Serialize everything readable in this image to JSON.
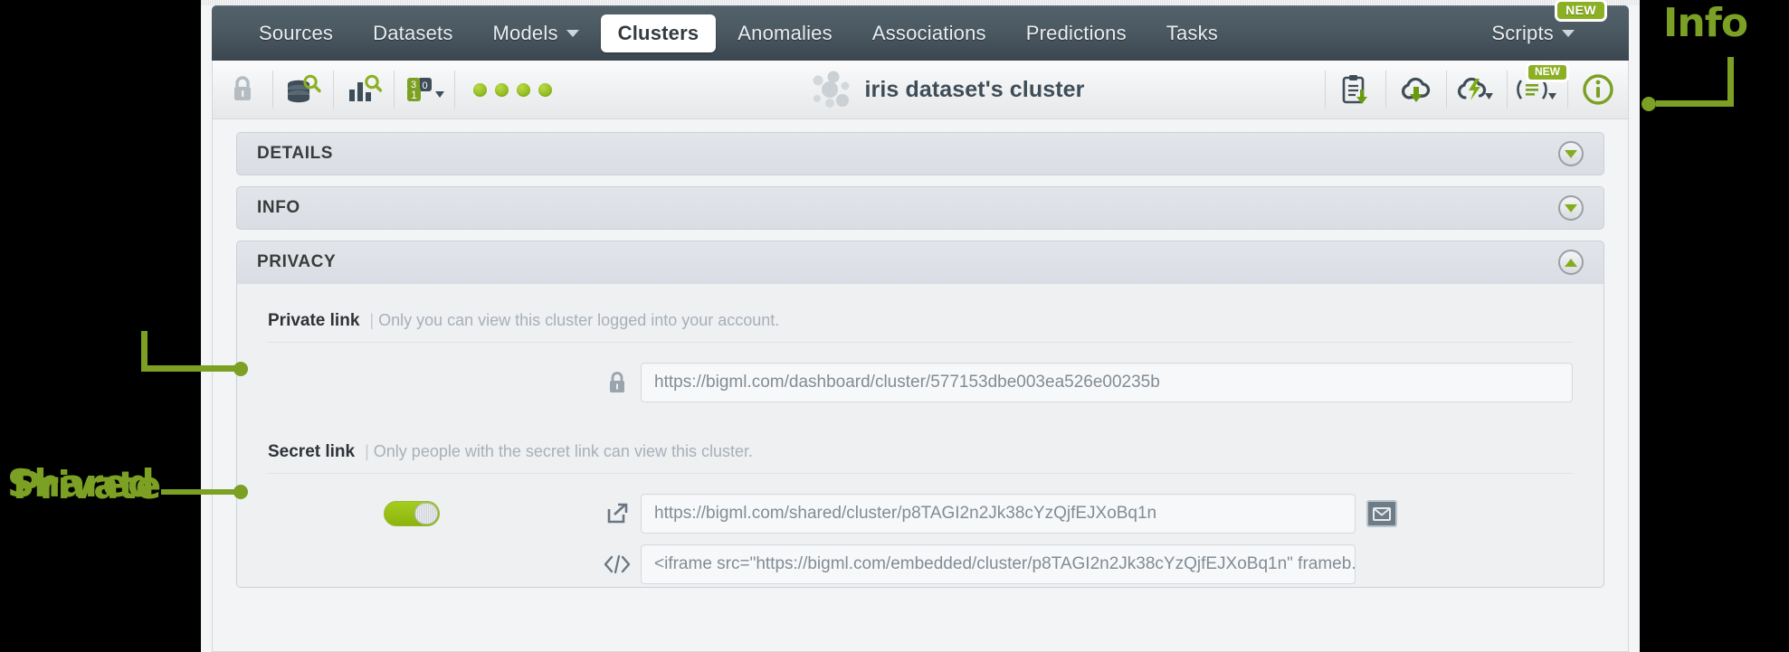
{
  "nav": {
    "items": [
      {
        "label": "Sources",
        "active": false,
        "caret": false
      },
      {
        "label": "Datasets",
        "active": false,
        "caret": false
      },
      {
        "label": "Models",
        "active": false,
        "caret": true
      },
      {
        "label": "Clusters",
        "active": true,
        "caret": false
      },
      {
        "label": "Anomalies",
        "active": false,
        "caret": false
      },
      {
        "label": "Associations",
        "active": false,
        "caret": false
      },
      {
        "label": "Predictions",
        "active": false,
        "caret": false
      },
      {
        "label": "Tasks",
        "active": false,
        "caret": false
      }
    ],
    "scripts_label": "Scripts",
    "scripts_badge": "NEW"
  },
  "toolbar": {
    "title": "iris dataset's cluster",
    "left_icons": [
      "lock-icon",
      "dataset-search-icon",
      "model-search-icon",
      "batch-centroid-icon"
    ],
    "status_dots": 4,
    "right_icons": [
      "download-clipboard-icon",
      "cloud-download-icon",
      "flash-cloud-icon",
      "script-icon",
      "info-icon"
    ],
    "script_badge": "NEW"
  },
  "accordions": [
    {
      "title": "DETAILS",
      "expanded": false
    },
    {
      "title": "INFO",
      "expanded": false
    },
    {
      "title": "PRIVACY",
      "expanded": true
    }
  ],
  "privacy": {
    "private": {
      "label": "Private link",
      "separator": "|",
      "description": "Only you can view this cluster logged into your account.",
      "url": "https://bigml.com/dashboard/cluster/577153dbe003ea526e00235b",
      "icon": "lock-icon"
    },
    "secret": {
      "label": "Secret link",
      "separator": "|",
      "description": "Only people with the secret link can view this cluster.",
      "toggle_on": true,
      "share_url": "https://bigml.com/shared/cluster/p8TAGI2n2Jk38cYzQjfEJXoBq1n",
      "share_icon": "share-external-icon",
      "mail_icon": "envelope-icon",
      "embed_code": "<iframe src=\"https://bigml.com/embedded/cluster/p8TAGI2n2Jk38cYzQjfEJXoBq1n\" frameb...",
      "embed_icon": "code-brackets-icon"
    }
  },
  "annotations": [
    {
      "text": "Private",
      "target": "private-link-row"
    },
    {
      "text": "Shared",
      "target": "secret-link-row"
    },
    {
      "text": "Info",
      "target": "info-icon"
    }
  ],
  "colors": {
    "accent_green": "#7ba024",
    "badge_green": "#8cb023",
    "nav_dark": "#4b5963",
    "panel_bg": "#eef0f2"
  }
}
